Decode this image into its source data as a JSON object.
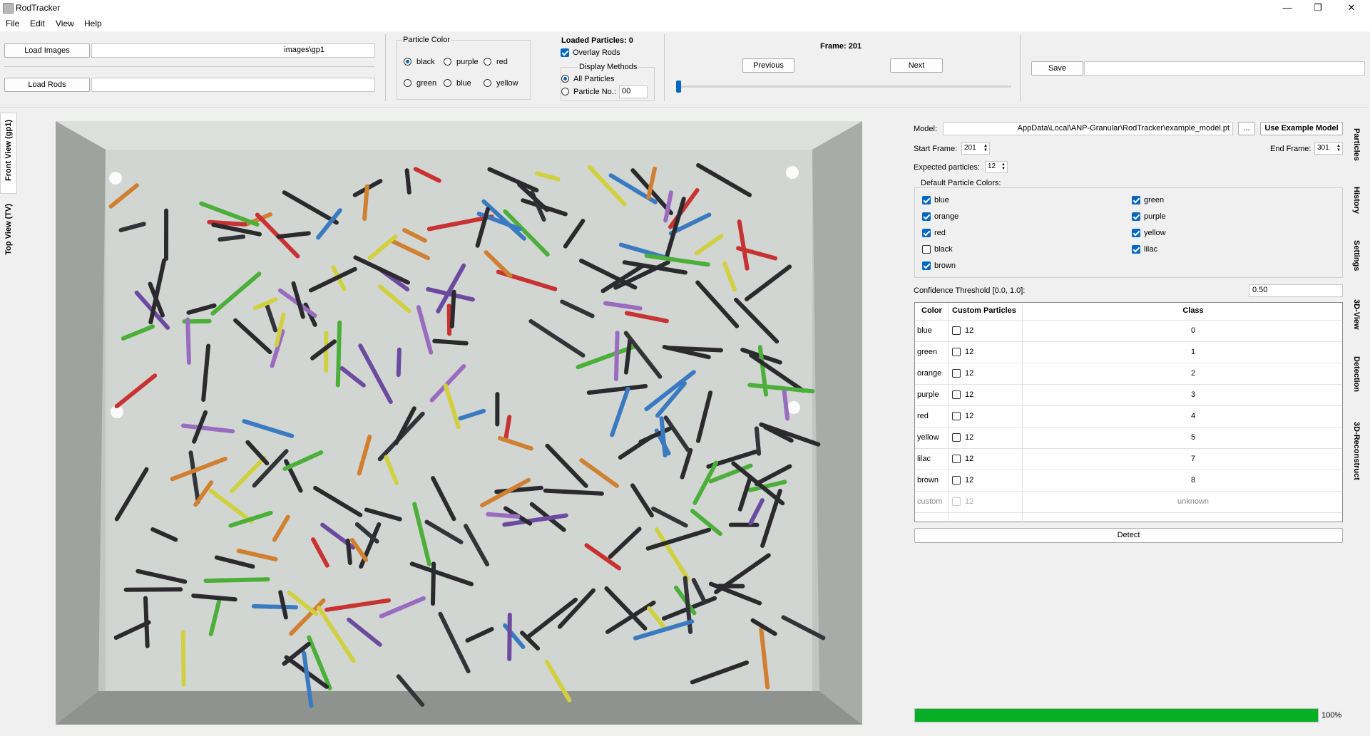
{
  "window": {
    "title": "RodTracker",
    "minimize": "—",
    "maximize": "❐",
    "close": "✕"
  },
  "menu": [
    "File",
    "Edit",
    "View",
    "Help"
  ],
  "toolbar": {
    "load_images": "Load Images",
    "images_path": "images\\gp1",
    "load_rods": "Load Rods",
    "rods_path": "",
    "particle_color_label": "Particle Color",
    "particle_colors": [
      {
        "label": "black",
        "selected": true
      },
      {
        "label": "purple",
        "selected": false
      },
      {
        "label": "red",
        "selected": false
      },
      {
        "label": "green",
        "selected": false
      },
      {
        "label": "blue",
        "selected": false
      },
      {
        "label": "yellow",
        "selected": false
      }
    ],
    "loaded_particles": "Loaded Particles: 0",
    "overlay_rods": "Overlay Rods",
    "display_methods_label": "Display Methods",
    "all_particles": "All Particles",
    "particle_no": "Particle No.:",
    "particle_no_value": "00",
    "frame_label": "Frame: 201",
    "previous": "Previous",
    "next": "Next",
    "save": "Save",
    "save_path": ""
  },
  "left_tabs": [
    "Front View (gp1)",
    "Top View (TV)"
  ],
  "right_tabs": [
    "Particles",
    "History",
    "Settings",
    "3D-View",
    "Detection",
    "3D-Reconstruct"
  ],
  "detection": {
    "model_label": "Model:",
    "model_path": "AppData\\Local\\ANP-Granular\\RodTracker\\example_model.pt",
    "browse": "...",
    "use_example": "Use Example Model",
    "start_frame_label": "Start Frame:",
    "start_frame": "201",
    "end_frame_label": "End Frame:",
    "end_frame": "301",
    "expected_label": "Expected particles:",
    "expected": "12",
    "default_colors_label": "Default Particle Colors:",
    "default_colors_left": [
      {
        "label": "blue",
        "checked": true
      },
      {
        "label": "orange",
        "checked": true
      },
      {
        "label": "red",
        "checked": true
      },
      {
        "label": "black",
        "checked": false
      },
      {
        "label": "brown",
        "checked": true
      }
    ],
    "default_colors_right": [
      {
        "label": "green",
        "checked": true
      },
      {
        "label": "purple",
        "checked": true
      },
      {
        "label": "yellow",
        "checked": true
      },
      {
        "label": "lilac",
        "checked": true
      }
    ],
    "confidence_label": "Confidence Threshold [0.0, 1.0]:",
    "confidence": "0.50",
    "table_headers": [
      "Color",
      "Custom Particles",
      "Class"
    ],
    "table_rows": [
      {
        "color": "blue",
        "count": "12",
        "cls": "0",
        "enabled": true
      },
      {
        "color": "green",
        "count": "12",
        "cls": "1",
        "enabled": true
      },
      {
        "color": "orange",
        "count": "12",
        "cls": "2",
        "enabled": true
      },
      {
        "color": "purple",
        "count": "12",
        "cls": "3",
        "enabled": true
      },
      {
        "color": "red",
        "count": "12",
        "cls": "4",
        "enabled": true
      },
      {
        "color": "yellow",
        "count": "12",
        "cls": "5",
        "enabled": true
      },
      {
        "color": "lilac",
        "count": "12",
        "cls": "7",
        "enabled": true
      },
      {
        "color": "brown",
        "count": "12",
        "cls": "8",
        "enabled": true
      },
      {
        "color": "custom",
        "count": "12",
        "cls": "unknown",
        "enabled": false
      }
    ],
    "detect": "Detect",
    "progress": 1.0,
    "progress_text": "100%"
  },
  "colors": {
    "accent": "#0067c0",
    "progress": "#06b025"
  }
}
